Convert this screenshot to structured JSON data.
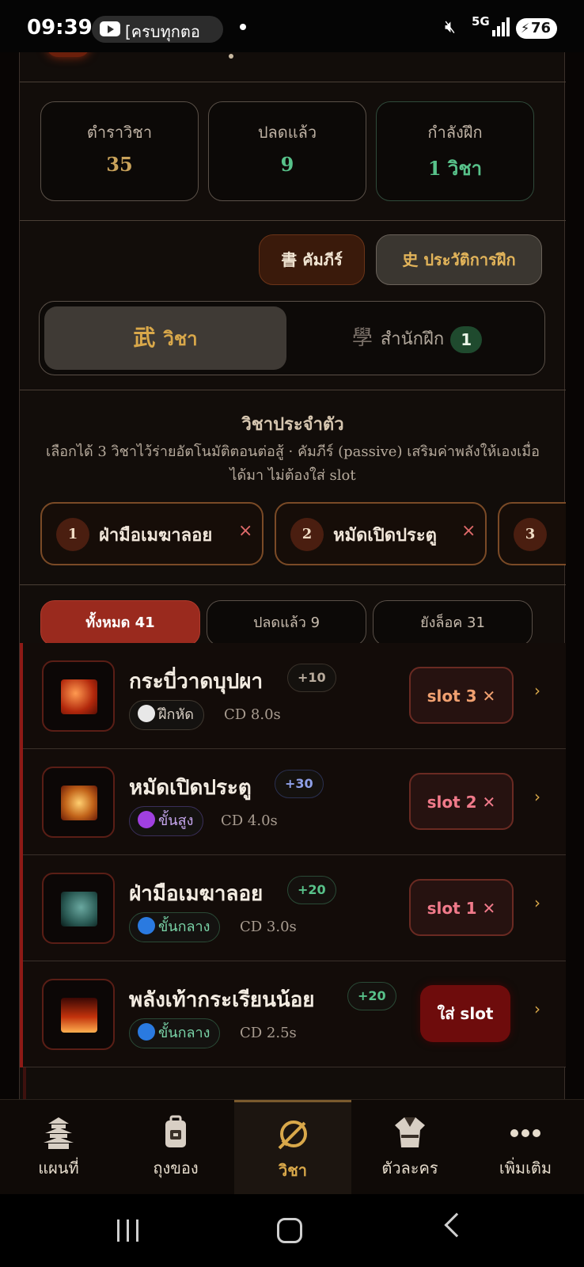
{
  "status_bar": {
    "time": "09:39",
    "notification_text": "[ครบทุกตอ",
    "network": "5G",
    "battery": "76"
  },
  "stats": [
    {
      "label": "ตำราวิชา",
      "value": "35",
      "color": "#c9a25a"
    },
    {
      "label": "ปลดแล้ว",
      "value": "9",
      "color": "#58c28a"
    },
    {
      "label": "กำลังฝึก",
      "value": "1 วิชา",
      "color": "#58c28a"
    }
  ],
  "actions": {
    "book": "書 คัมภีร์",
    "history": "史 ประวัติการฝึก"
  },
  "tabs": {
    "skill_kanji": "武",
    "skill_label": "วิชา",
    "school_kanji": "學",
    "school_label": "สำนักฝึก",
    "school_badge": "1"
  },
  "equipped": {
    "title": "วิชาประจำตัว",
    "description": "เลือกได้ 3 วิชาไว้ร่ายอัตโนมัติตอนต่อสู้ · คัมภีร์ (passive) เสริมค่าพลังให้เองเมื่อได้มา ไม่ต้องใส่ slot",
    "slots": [
      {
        "num": "1",
        "name": "ฝ่ามือเมฆาลอย",
        "remove": "×"
      },
      {
        "num": "2",
        "name": "หมัดเปิดประตู",
        "remove": "×"
      },
      {
        "num": "3",
        "name": "",
        "remove": ""
      }
    ]
  },
  "filters": [
    {
      "label": "ทั้งหมด 41",
      "active": true
    },
    {
      "label": "ปลดแล้ว 9",
      "active": false
    },
    {
      "label": "ยังล็อค 31",
      "active": false
    }
  ],
  "skills": [
    {
      "name": "กระบี่วาดบุปผา",
      "boost": "+10",
      "boost_color": "#b8ab9c",
      "rank": "ฝึกหัด",
      "rank_color": "#d8cfc4",
      "dot_color": "#e8e8e8",
      "cd": "CD 8.0s",
      "slot": "slot 3 ✕",
      "slot_color": "#f0a070",
      "icon_color": "#b2280c"
    },
    {
      "name": "หมัดเปิดประตู",
      "boost": "+30",
      "boost_color": "#8fa0e8",
      "rank": "ขั้นสูง",
      "rank_color": "#c8a8f0",
      "dot_color": "#a040e0",
      "cd": "CD 4.0s",
      "slot": "slot 2 ✕",
      "slot_color": "#f07a8a",
      "icon_color": "#c2641a"
    },
    {
      "name": "ฝ่ามือเมฆาลอย",
      "boost": "+20",
      "boost_color": "#58c28a",
      "rank": "ขั้นกลาง",
      "rank_color": "#7ac8f0",
      "dot_color": "#2a7ae0",
      "cd": "CD 3.0s",
      "slot": "slot 1 ✕",
      "slot_color": "#f07a8a",
      "icon_color": "#2a5a54"
    },
    {
      "name": "พลังเท้ากระเรียนน้อย",
      "boost": "+20",
      "boost_color": "#58c28a",
      "rank": "ขั้นกลาง",
      "rank_color": "#7ac8f0",
      "dot_color": "#2a7ae0",
      "cd": "CD 2.5s",
      "assign": "ใส่ slot",
      "icon_color": "#c2320c"
    }
  ],
  "bottom_nav": [
    {
      "label": "แผนที่",
      "icon": "pagoda-icon",
      "active": false
    },
    {
      "label": "ถุงของ",
      "icon": "backpack-icon",
      "active": false
    },
    {
      "label": "วิชา",
      "icon": "sword-skill-icon",
      "active": true
    },
    {
      "label": "ตัวละคร",
      "icon": "robe-icon",
      "active": false
    },
    {
      "label": "เพิ่มเติม",
      "icon": "more-icon",
      "active": false
    }
  ]
}
